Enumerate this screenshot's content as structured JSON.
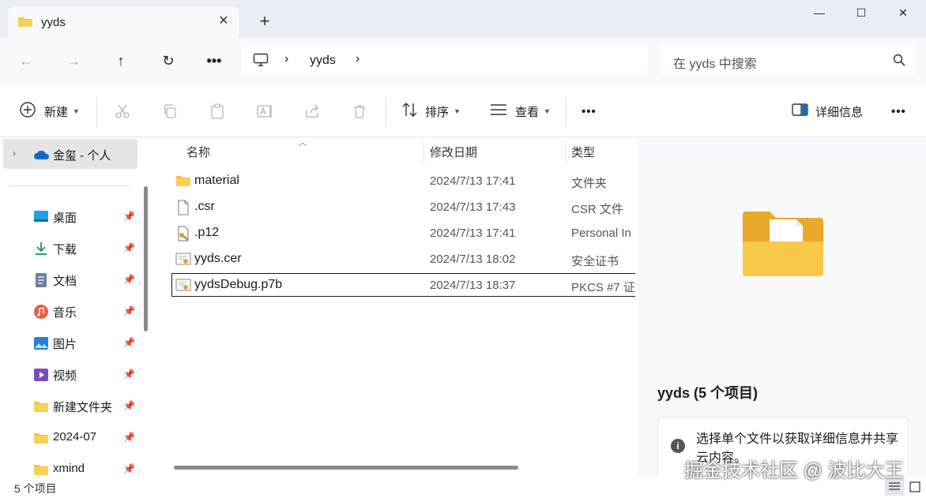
{
  "window": {
    "tab_title": "yyds",
    "tab_close": "✕",
    "new_tab": "+",
    "minimize": "—",
    "maximize": "☐",
    "close": "✕"
  },
  "address": {
    "breadcrumb": [
      "yyds"
    ],
    "search_placeholder": "在 yyds 中搜索"
  },
  "toolbar": {
    "new_label": "新建",
    "sort_label": "排序",
    "view_label": "查看",
    "details_label": "详细信息"
  },
  "nav": {
    "onedrive_label": "金玺 - 个人",
    "items": [
      {
        "label": "桌面",
        "icon": "desktop-icon"
      },
      {
        "label": "下载",
        "icon": "download-icon"
      },
      {
        "label": "文档",
        "icon": "document-icon"
      },
      {
        "label": "音乐",
        "icon": "music-icon"
      },
      {
        "label": "图片",
        "icon": "picture-icon"
      },
      {
        "label": "视频",
        "icon": "video-icon"
      },
      {
        "label": "新建文件夹",
        "icon": "folder-icon"
      },
      {
        "label": "2024-07",
        "icon": "folder-icon"
      },
      {
        "label": "xmind",
        "icon": "folder-icon"
      }
    ]
  },
  "files": {
    "columns": [
      "名称",
      "修改日期",
      "类型"
    ],
    "rows": [
      {
        "name": "material",
        "date": "2024/7/13 17:41",
        "type": "文件夹",
        "icon": "folder-icon"
      },
      {
        "name": ".csr",
        "date": "2024/7/13 17:43",
        "type": "CSR 文件",
        "icon": "file-icon"
      },
      {
        "name": ".p12",
        "date": "2024/7/13 17:41",
        "type": "Personal In",
        "icon": "certificate-key-icon"
      },
      {
        "name": "yyds.cer",
        "date": "2024/7/13 18:02",
        "type": "安全证书",
        "icon": "certificate-icon"
      },
      {
        "name": "yydsDebug.p7b",
        "date": "2024/7/13 18:37",
        "type": "PKCS #7 证",
        "icon": "certificate-icon"
      }
    ]
  },
  "details": {
    "title": "yyds (5 个项目)",
    "info": "选择单个文件以获取详细信息并共享云内容。"
  },
  "status": {
    "item_count": "5 个项目"
  },
  "watermark": "掘金技术社区 @ 波比大王",
  "colors": {
    "titlebar_bg": "#e9eef5",
    "folder_yellow": "#f5c242",
    "accent_blue": "#0f6cbd"
  }
}
